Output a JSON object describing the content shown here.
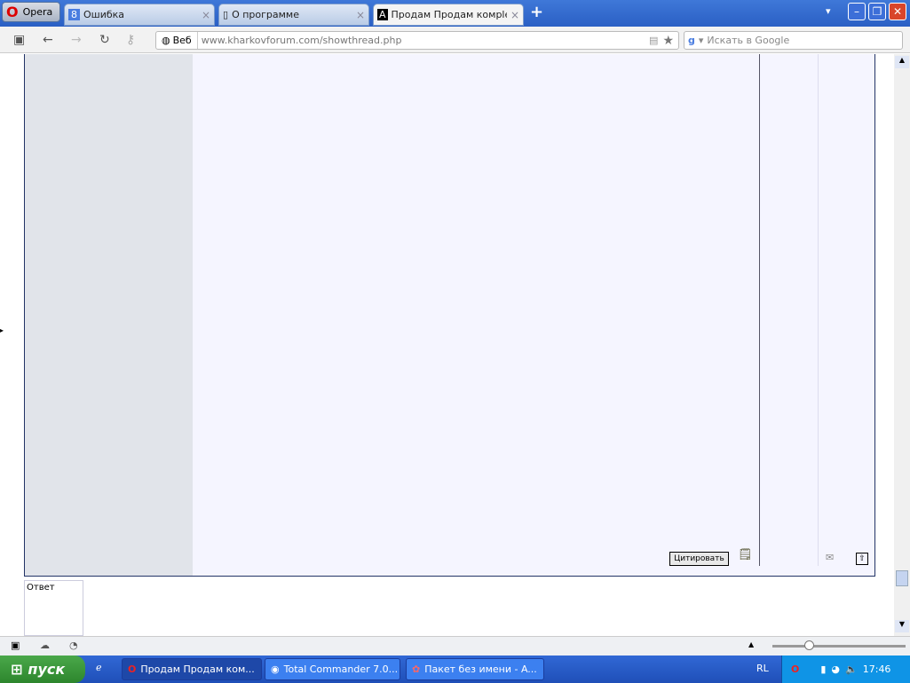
{
  "browser": {
    "menu_label": "Opera",
    "tabs": [
      {
        "label": "Ошибка"
      },
      {
        "label": "О программе"
      },
      {
        "label": "Продам Продам комple..."
      }
    ],
    "new_tab": "+",
    "web_label": "Веб",
    "url_host": "www.kharkovforum.com",
    "url_path": "/showthread.php",
    "search_placeholder": "Искать в Google"
  },
  "page": {
    "quote_button": "Цитировать",
    "reply_label": "Ответ"
  },
  "taskbar": {
    "start": "пуск",
    "tasks": [
      {
        "label": "Продам Продам ком..."
      },
      {
        "label": "Total Commander 7.0..."
      },
      {
        "label": "Пакет без имени - A..."
      }
    ],
    "lang": "RL",
    "clock": "17:46"
  }
}
